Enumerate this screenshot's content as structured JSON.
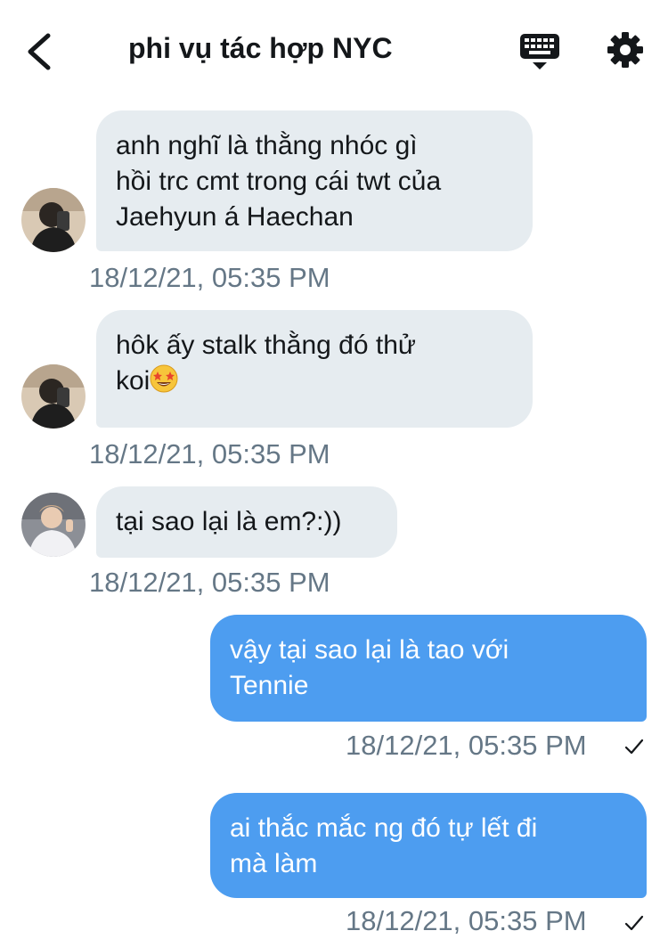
{
  "header": {
    "title": "phi vụ tác hợp NYC",
    "back_icon": "chevron-left-icon",
    "keyboard_icon": "keyboard-icon",
    "settings_icon": "gear-icon"
  },
  "colors": {
    "incoming_bubble": "#e6ecf0",
    "outgoing_bubble": "#4d9df0",
    "timestamp": "#657786",
    "text": "#14171a"
  },
  "messages": [
    {
      "direction": "incoming",
      "text": "anh nghĩ là thằng nhóc gì\nhồi trc cmt trong cái twt của\nJaehyun á Haechan",
      "timestamp": "18/12/21, 05:35 PM"
    },
    {
      "direction": "incoming",
      "text": "hôk ấy stalk thằng đó thử\nkoi",
      "emoji": "star-struck-emoji",
      "timestamp": "18/12/21, 05:35 PM"
    },
    {
      "direction": "incoming",
      "text": "tại sao lại là em?:))",
      "timestamp": "18/12/21, 05:35 PM"
    },
    {
      "direction": "outgoing",
      "text": "vậy tại sao lại là tao với\nTennie",
      "timestamp": "18/12/21, 05:35 PM",
      "status_icon": "checkmark-icon"
    },
    {
      "direction": "outgoing",
      "text": "ai thắc mắc ng đó tự lết đi\nmà làm",
      "timestamp": "18/12/21, 05:35 PM",
      "status_icon": "checkmark-icon"
    }
  ]
}
